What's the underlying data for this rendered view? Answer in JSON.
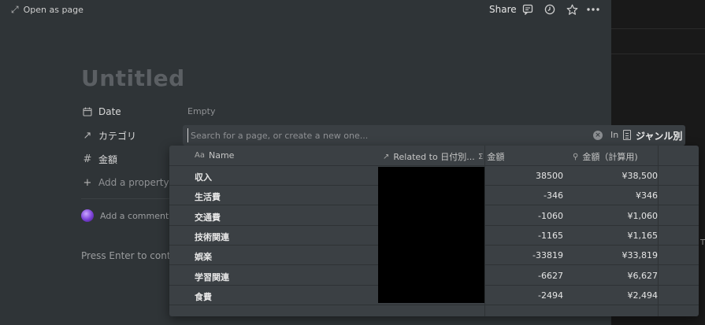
{
  "topbar": {
    "open_as_page": "Open as page",
    "share": "Share",
    "icons": [
      "comment-icon",
      "clock-icon",
      "star-icon",
      "more-icon"
    ]
  },
  "page": {
    "title": "Untitled",
    "properties": [
      {
        "icon": "calendar-icon",
        "label": "Date",
        "value": "Empty"
      },
      {
        "icon": "relation-arrow-icon",
        "label": "カテゴリ"
      },
      {
        "icon": "number-hash-icon",
        "label": "金額"
      }
    ],
    "add_property": "Add a property",
    "add_comment": "Add a comment...",
    "press_enter": "Press Enter to continue with an empty page"
  },
  "search": {
    "placeholder": "Search for a page, or create a new one...",
    "in_label": "In",
    "database_name": "ジャンル別"
  },
  "results": {
    "headers": {
      "name": "Name",
      "related": "Related to 日付別...",
      "amount": "金額",
      "calc": "金額（計算用)"
    },
    "rows": [
      {
        "name": "収入",
        "amount": "38500",
        "calc": "¥38,500"
      },
      {
        "name": "生活費",
        "amount": "-346",
        "calc": "¥346"
      },
      {
        "name": "交通費",
        "amount": "-1060",
        "calc": "¥1,060"
      },
      {
        "name": "技術関連",
        "amount": "-1165",
        "calc": "¥1,165"
      },
      {
        "name": "娯楽",
        "amount": "-33819",
        "calc": "¥33,819"
      },
      {
        "name": "学習関連",
        "amount": "-6627",
        "calc": "¥6,627"
      },
      {
        "name": "食費",
        "amount": "-2494",
        "calc": "¥2,494"
      }
    ]
  },
  "right_panel": {
    "char": "T"
  }
}
